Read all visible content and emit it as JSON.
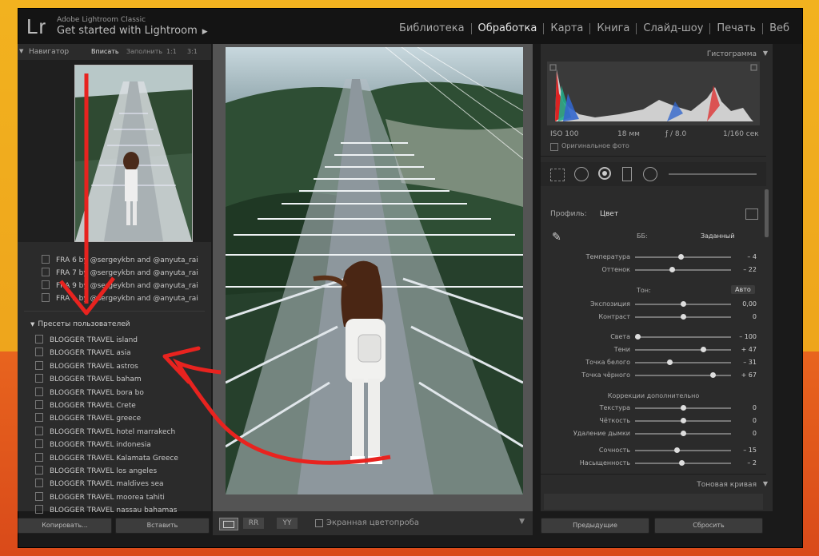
{
  "app": {
    "logo": "Lr",
    "name": "Adobe Lightroom Classic",
    "subtitle": "Get started with Lightroom",
    "modules": [
      "Библиотека",
      "Обработка",
      "Карта",
      "Книга",
      "Слайд-шоу",
      "Печать",
      "Веб"
    ],
    "active_module": "Обработка"
  },
  "navigator": {
    "title": "Навигатор",
    "zoom": [
      "Вписать",
      "Заполнить",
      "1:1",
      "3:1"
    ],
    "active_zoom": "Вписать"
  },
  "presets": {
    "partial_items": [
      "FRA 6 by @sergeykbn and @anyuta_rai",
      "FRA 7 by @sergeykbn and @anyuta_rai",
      "FRA 9 by @sergeykbn and @anyuta_rai",
      "FRA 1 by @sergeykbn and @anyuta_rai"
    ],
    "group": "Пресеты пользователей",
    "items": [
      "BLOGGER TRAVEL island",
      "BLOGGER TRAVEL asia",
      "BLOGGER TRAVEL astros",
      "BLOGGER TRAVEL baham",
      "BLOGGER TRAVEL bora bo",
      "BLOGGER TRAVEL Crete",
      "BLOGGER TRAVEL greece",
      "BLOGGER TRAVEL hotel marrakech",
      "BLOGGER TRAVEL indonesia",
      "BLOGGER TRAVEL Kalamata Greece",
      "BLOGGER TRAVEL los angeles",
      "BLOGGER TRAVEL maldives sea",
      "BLOGGER TRAVEL moorea tahiti",
      "BLOGGER TRAVEL nassau bahamas"
    ]
  },
  "left_buttons": {
    "copy": "Копировать...",
    "paste": "Вставить"
  },
  "toolbar": {
    "softproof": "Экранная цветопроба"
  },
  "histogram": {
    "title": "Гистограмма",
    "iso": "ISO 100",
    "focal": "18 мм",
    "aperture": "ƒ / 8.0",
    "shutter": "1/160 сек",
    "original": "Оригинальное фото"
  },
  "basic": {
    "profile_label": "Профиль:",
    "profile_value": "Цвет",
    "wb_label": "ББ:",
    "wb_value": "Заданный",
    "tone_label": "Тон:",
    "auto": "Авто",
    "presence_label": "Коррекции дополнительно",
    "sliders": [
      {
        "label": "Температура",
        "value": "– 4",
        "pos": 0.48
      },
      {
        "label": "Оттенок",
        "value": "– 22",
        "pos": 0.38
      },
      {
        "label": "Экспозиция",
        "value": "0,00",
        "pos": 0.5
      },
      {
        "label": "Контраст",
        "value": "0",
        "pos": 0.5
      },
      {
        "label": "Света",
        "value": "– 100",
        "pos": 0.0
      },
      {
        "label": "Тени",
        "value": "+ 47",
        "pos": 0.73
      },
      {
        "label": "Точка белого",
        "value": "– 31",
        "pos": 0.35
      },
      {
        "label": "Точка чёрного",
        "value": "+ 67",
        "pos": 0.83
      },
      {
        "label": "Текстура",
        "value": "0",
        "pos": 0.5
      },
      {
        "label": "Чёткость",
        "value": "0",
        "pos": 0.5
      },
      {
        "label": "Удаление дымки",
        "value": "0",
        "pos": 0.5
      },
      {
        "label": "Сочность",
        "value": "– 15",
        "pos": 0.43
      },
      {
        "label": "Насыщенность",
        "value": "– 2",
        "pos": 0.49
      }
    ]
  },
  "tone_curve": {
    "title": "Тоновая кривая"
  },
  "right_buttons": {
    "previous": "Предыдущие",
    "reset": "Сбросить"
  },
  "colors": {
    "annotation": "#e8231f",
    "background_top": "#f2b21f",
    "background_bottom": "#e8641e"
  }
}
